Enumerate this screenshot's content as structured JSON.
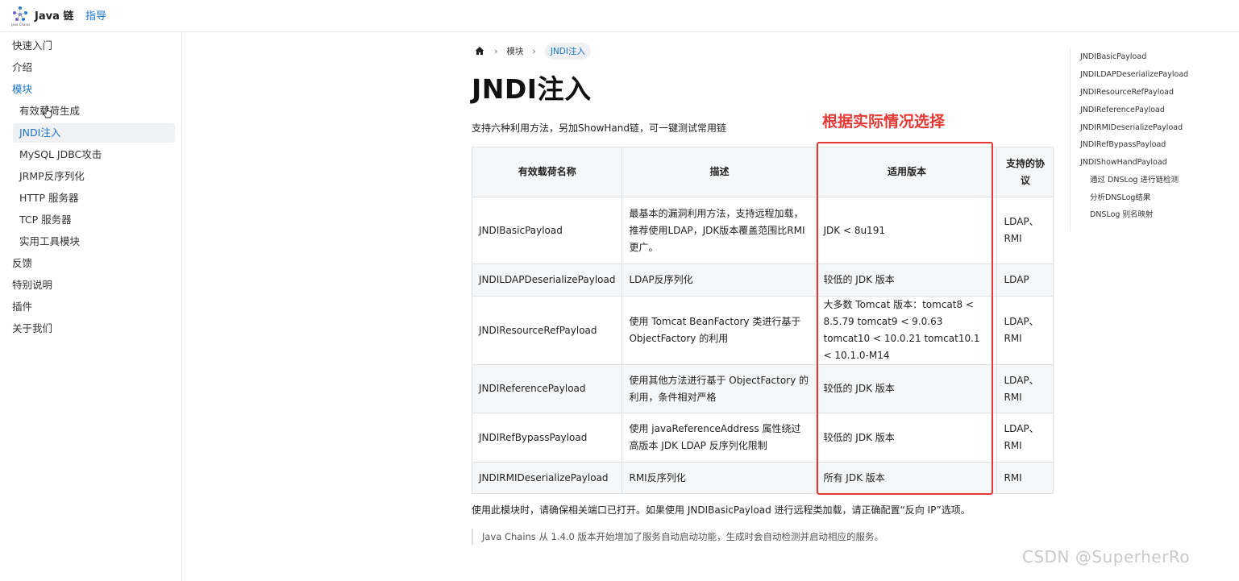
{
  "header": {
    "brand": "Java 链",
    "logo_caption": "Java Chains",
    "nav_guide": "指导"
  },
  "sidebar": {
    "items": [
      {
        "label": "快速入门"
      },
      {
        "label": "介绍"
      },
      {
        "label": "模块"
      },
      {
        "label": "有效载荷生成"
      },
      {
        "label": "JNDI注入"
      },
      {
        "label": "MySQL JDBC攻击"
      },
      {
        "label": "JRMP反序列化"
      },
      {
        "label": "HTTP 服务器"
      },
      {
        "label": "TCP 服务器"
      },
      {
        "label": "实用工具模块"
      },
      {
        "label": "反馈"
      },
      {
        "label": "特别说明"
      },
      {
        "label": "插件"
      },
      {
        "label": "关于我们"
      }
    ]
  },
  "breadcrumb": {
    "home_icon": "home-icon",
    "parent": "模块",
    "current": "JNDI注入"
  },
  "page": {
    "title": "JNDI注入",
    "intro": "支持六种利用方法，另加ShowHand链，可一键测试常用链",
    "annotation": "根据实际情况选择",
    "note": "使用此模块时，请确保相关端口已打开。如果使用 JNDIBasicPayload 进行远程类加载，请正确配置“反向 IP”选项。",
    "quote": "Java Chains 从 1.4.0 版本开始增加了服务自动启动功能，生成时会自动检测并启动相应的服务。"
  },
  "table": {
    "headers": [
      "有效载荷名称",
      "描述",
      "适用版本",
      "支持的协议"
    ],
    "rows": [
      {
        "name": "JNDIBasicPayload",
        "desc": "最基本的漏洞利用方法，支持远程加载，推荐使用LDAP，JDK版本覆盖范围比RMI更广。",
        "version": "JDK < 8u191",
        "protocol": "LDAP、RMI"
      },
      {
        "name": "JNDILDAPDeserializePayload",
        "desc": "LDAP反序列化",
        "version": "较低的 JDK 版本",
        "protocol": "LDAP"
      },
      {
        "name": "JNDIResourceRefPayload",
        "desc": "使用 Tomcat BeanFactory 类进行基于 ObjectFactory 的利用",
        "version": "大多数 Tomcat 版本：tomcat8 < 8.5.79 tomcat9 < 9.0.63 tomcat10 < 10.0.21 tomcat10.1 < 10.1.0-M14",
        "protocol": "LDAP、RMI"
      },
      {
        "name": "JNDIReferencePayload",
        "desc": "使用其他方法进行基于 ObjectFactory 的利用，条件相对严格",
        "version": "较低的 JDK 版本",
        "protocol": "LDAP、RMI"
      },
      {
        "name": "JNDIRefBypassPayload",
        "desc": "使用 javaReferenceAddress 属性绕过高版本 JDK LDAP 反序列化限制",
        "version": "较低的 JDK 版本",
        "protocol": "LDAP、RMI"
      },
      {
        "name": "JNDIRMIDeserializePayload",
        "desc": "RMI反序列化",
        "version": "所有 JDK 版本",
        "protocol": "RMI"
      }
    ]
  },
  "toc": {
    "items": [
      {
        "label": "JNDIBasicPayload"
      },
      {
        "label": "JNDILDAPDeserializePayload"
      },
      {
        "label": "JNDIResourceRefPayload"
      },
      {
        "label": "JNDIReferencePayload"
      },
      {
        "label": "JNDIRMIDeserializePayload"
      },
      {
        "label": "JNDIRefBypassPayload"
      },
      {
        "label": "JNDIShowHandPayload"
      },
      {
        "label": "通过 DNSLog 进行链检测"
      },
      {
        "label": "分析DNSLog结果"
      },
      {
        "label": "DNSLog 别名映射"
      }
    ]
  },
  "watermark": "CSDN @SuperherRo",
  "colors": {
    "accent": "#1a73c9",
    "annotation": "#e53935",
    "header_bg": "#f6f7f8"
  }
}
